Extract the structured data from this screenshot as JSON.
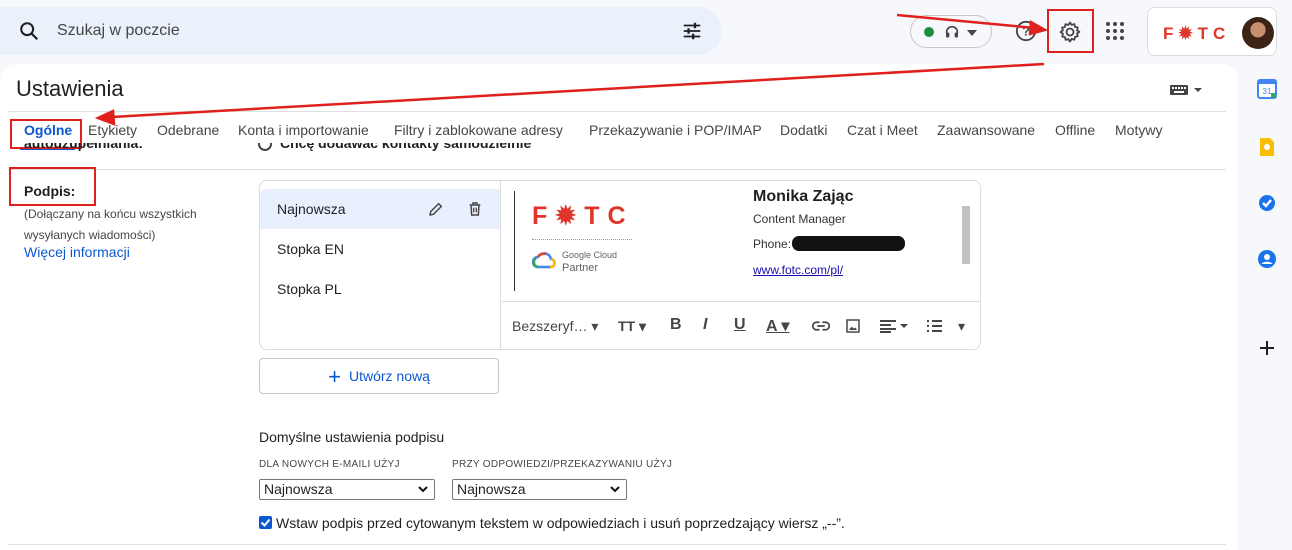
{
  "search": {
    "placeholder": "Szukaj w poczcie",
    "icon": "search-icon",
    "filter_icon": "tune-icon"
  },
  "header": {
    "status_color": "#1e8e3e",
    "help_icon": "help-icon",
    "settings_icon": "gear-icon",
    "apps_icon": "apps-grid-icon",
    "account_logo": "F✹TC"
  },
  "page": {
    "title": "Ustawienia"
  },
  "tabs": [
    {
      "label": "Ogólne",
      "active": true
    },
    {
      "label": "Etykiety"
    },
    {
      "label": "Odebrane"
    },
    {
      "label": "Konta i importowanie"
    },
    {
      "label": "Filtry i zablokowane adresy"
    },
    {
      "label": "Przekazywanie i POP/IMAP"
    },
    {
      "label": "Dodatki"
    },
    {
      "label": "Czat i Meet"
    },
    {
      "label": "Zaawansowane"
    },
    {
      "label": "Offline"
    },
    {
      "label": "Motywy"
    }
  ],
  "cut_row": {
    "label": "autouzupełniania:",
    "option": "Chcę dodawać kontakty samodzielnie"
  },
  "signature": {
    "label": "Podpis:",
    "desc": "(Dołączany na końcu wszystkich wysyłanych wiadomości)",
    "more": "Więcej informacji",
    "items": [
      "Najnowsza",
      "Stopka EN",
      "Stopka PL"
    ],
    "preview": {
      "logo": "F✹TC",
      "gc_line1": "Google Cloud",
      "gc_line2": "Partner",
      "name": "Monika Zając",
      "role": "Content Manager",
      "phone_label": "Phone:",
      "link": "www.fotc.com/pl/"
    },
    "toolbar": {
      "font": "Bezszeryf…"
    },
    "create": "Utwórz nową"
  },
  "defaults": {
    "title": "Domyślne ustawienia podpisu",
    "new_label": "DLA NOWYCH E-MAILI UŻYJ",
    "reply_label": "PRZY ODPOWIEDZI/PRZEKAZYWANIU UŻYJ",
    "new_value": "Najnowsza",
    "reply_value": "Najnowsza",
    "checkbox_label": "Wstaw podpis przed cytowanym tekstem w odpowiedziach i usuń poprzedzający wiersz „--”.",
    "checkbox_checked": true
  },
  "annotation_color": "#e0201c"
}
